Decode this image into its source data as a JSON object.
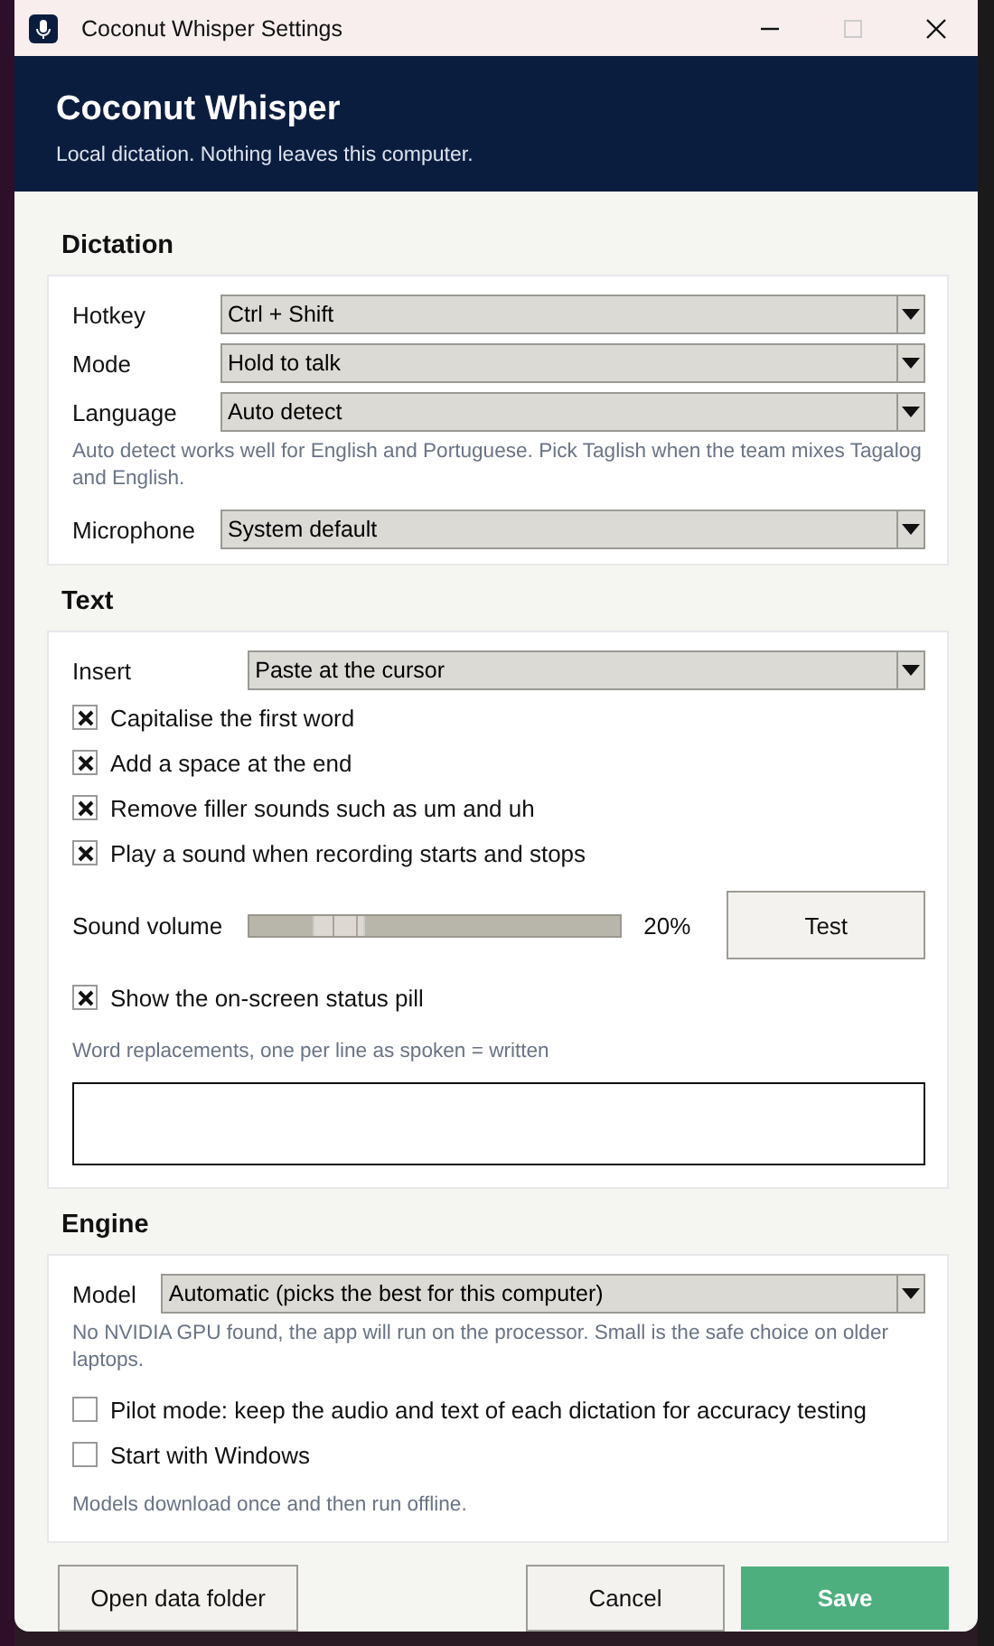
{
  "window": {
    "title": "Coconut Whisper Settings",
    "controls": [
      {
        "kind": "minimize",
        "disabled": false
      },
      {
        "kind": "maximize",
        "disabled": true
      },
      {
        "kind": "close",
        "disabled": false
      }
    ]
  },
  "header": {
    "title": "Coconut Whisper",
    "subtitle": "Local dictation. Nothing leaves this computer."
  },
  "sections": [
    {
      "title": "Dictation",
      "items": [
        {
          "kind": "dropdown",
          "label": "Hotkey",
          "value": "Ctrl + Shift"
        },
        {
          "kind": "dropdown",
          "label": "Mode",
          "value": "Hold to talk"
        },
        {
          "kind": "dropdown",
          "label": "Language",
          "value": "Auto detect"
        },
        {
          "kind": "note",
          "text": "Auto detect works well for English and Portuguese. Pick Taglish when the team mixes Tagalog and English."
        },
        {
          "kind": "dropdown",
          "label": "Microphone",
          "value": "System default"
        }
      ]
    },
    {
      "title": "Text",
      "items": [
        {
          "kind": "dropdown",
          "label": "Insert",
          "value": "Paste at the cursor"
        },
        {
          "kind": "checkbox",
          "label": "Capitalise the first word",
          "checked": true
        },
        {
          "kind": "checkbox",
          "label": "Add a space at the end",
          "checked": true
        },
        {
          "kind": "checkbox",
          "label": "Remove filler sounds such as um and uh",
          "checked": true
        },
        {
          "kind": "checkbox",
          "label": "Play a sound when recording starts and stops",
          "checked": true
        },
        {
          "kind": "slider",
          "label": "Sound volume",
          "level": 0.2,
          "reading": "20%",
          "button": "Test"
        },
        {
          "kind": "checkbox",
          "label": "Show the on-screen status pill",
          "checked": true
        },
        {
          "kind": "textarea",
          "label": "Word replacements, one per line as spoken = written"
        }
      ]
    },
    {
      "title": "Engine",
      "items": [
        {
          "kind": "dropdown",
          "label": "Model",
          "value": "Automatic (picks the best for this computer)"
        },
        {
          "kind": "note",
          "text": "No NVIDIA GPU found, the app will run on the processor. Small is the safe choice on older laptops."
        },
        {
          "kind": "checkbox",
          "label": "Pilot mode: keep the audio and text of each dictation for accuracy testing",
          "checked": false
        },
        {
          "kind": "checkbox",
          "label": "Start with Windows",
          "checked": false
        },
        {
          "kind": "footnote",
          "text": "Models download once and then run offline."
        }
      ]
    }
  ],
  "footer": {
    "left": "Open data folder",
    "cancel": "Cancel",
    "save": "Save"
  }
}
